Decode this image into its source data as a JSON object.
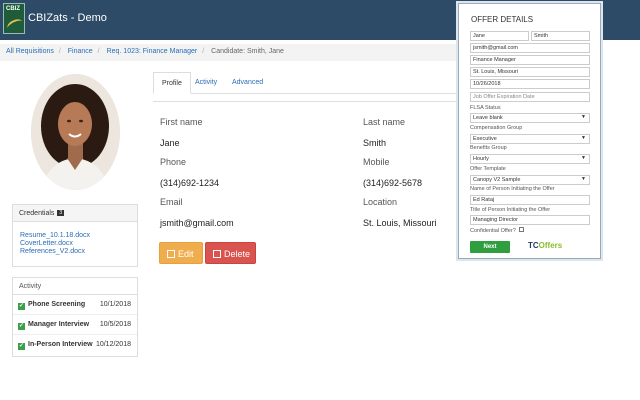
{
  "app": {
    "logo_text": "CBIZ",
    "title": "CBIZats - Demo"
  },
  "breadcrumb": [
    {
      "label": "All Requisitions",
      "link": true
    },
    {
      "label": "Finance",
      "link": true
    },
    {
      "label": "Req. 1023: Finance Manager",
      "link": true
    },
    {
      "label": "Candidate: Smith, Jane",
      "link": false
    }
  ],
  "credentials": {
    "title": "Credentials",
    "count": "3",
    "files": [
      "Resume_10.1.18.docx",
      "CoverLetter.docx",
      "References_V2.docx"
    ]
  },
  "activity": {
    "title": "Activity",
    "items": [
      {
        "label": "Phone Screening",
        "date": "10/1/2018"
      },
      {
        "label": "Manager Interview",
        "date": "10/5/2018"
      },
      {
        "label": "In-Person Interview",
        "date": "10/12/2018"
      }
    ]
  },
  "tabs": [
    "Profile",
    "Activity",
    "Advanced"
  ],
  "profile": {
    "first_name_label": "First name",
    "first_name": "Jane",
    "last_name_label": "Last name",
    "last_name": "Smith",
    "phone_label": "Phone",
    "phone": "(314)692-1234",
    "mobile_label": "Mobile",
    "mobile": "(314)692-5678",
    "email_label": "Email",
    "email": "jsmith@gmail.com",
    "location_label": "Location",
    "location": "St. Louis, Missouri",
    "edit_label": "Edit",
    "delete_label": "Delete"
  },
  "offer": {
    "title": "OFFER DETAILS",
    "first_name": "Jane",
    "last_name": "Smith",
    "email": "jsmith@gmail.com",
    "position": "Finance Manager",
    "location": "St. Louis, Missouri",
    "date": "10/26/2018",
    "expiration_placeholder": "Job Offer Expiration Date",
    "flsa_label": "FLSA Status",
    "flsa_value": "Leave blank",
    "comp_label": "Compensation Group",
    "comp_value": "Executive",
    "benefits_label": "Benefits Group",
    "benefits_value": "Hourly",
    "template_label": "Offer Template",
    "template_value": "Canopy V2 Sample",
    "initiator_label": "Name of Person Initiating the Offer",
    "initiator_value": "Ed Rataj",
    "initiator_title_label": "Title of Person Initiating the Offer",
    "initiator_title_value": "Managing Director",
    "confidential_label": "Confidential Offer?",
    "next_label": "Next",
    "brand_tc": "TC",
    "brand_offers": "Offers"
  },
  "colors": {
    "topbar": "#2d4a66",
    "link": "#2a6db5",
    "edit": "#f0ad4e",
    "delete": "#d9534f",
    "next": "#2e9e3e"
  }
}
